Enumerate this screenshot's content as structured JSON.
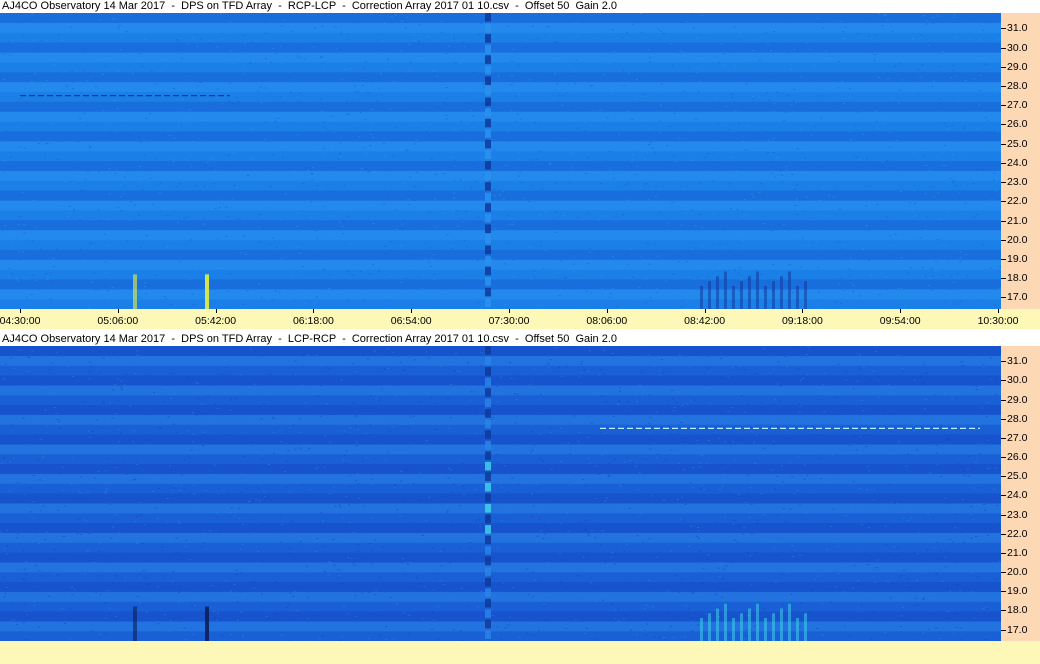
{
  "chart_data": [
    {
      "type": "heatmap",
      "title": "AJ4CO Observatory 14 Mar 2017  -  DPS on TFD Array  -  RCP-LCP  -  Correction Array 2017 01 10.csv  -  Offset 50  Gain 2.0",
      "y_ticks": [
        "31.0",
        "30.0",
        "29.0",
        "28.0",
        "27.0",
        "26.0",
        "25.0",
        "24.0",
        "23.0",
        "22.0",
        "21.0",
        "20.0",
        "19.0",
        "18.0",
        "17.0"
      ],
      "x_ticks": [
        "04:30:00",
        "05:06:00",
        "05:42:00",
        "06:18:00",
        "06:54:00",
        "07:30:00",
        "08:06:00",
        "08:42:00",
        "09:18:00",
        "09:54:00",
        "10:30:00"
      ],
      "ylim": [
        16.4,
        31.8
      ],
      "colors": {
        "base": "#1b7fe8",
        "dark_band": "#1760d4",
        "light_band": "#2a92f0",
        "marker_dark": "#0e3a9a",
        "marker_light": "#3fd0e8"
      }
    },
    {
      "type": "heatmap",
      "title": "AJ4CO Observatory 14 Mar 2017  -  DPS on TFD Array  -  LCP-RCP  -  Correction Array 2017 01 10.csv  -  Offset 50  Gain 2.0",
      "y_ticks": [
        "31.0",
        "30.0",
        "29.0",
        "28.0",
        "27.0",
        "26.0",
        "25.0",
        "24.0",
        "23.0",
        "22.0",
        "21.0",
        "20.0",
        "19.0",
        "18.0",
        "17.0"
      ],
      "ylim": [
        16.4,
        31.8
      ],
      "colors": {
        "base": "#1a5fd6",
        "dark_band": "#1448c4",
        "light_band": "#2a82e8",
        "marker_dark": "#0e3a9a",
        "marker_light": "#3fd0e8"
      }
    }
  ]
}
